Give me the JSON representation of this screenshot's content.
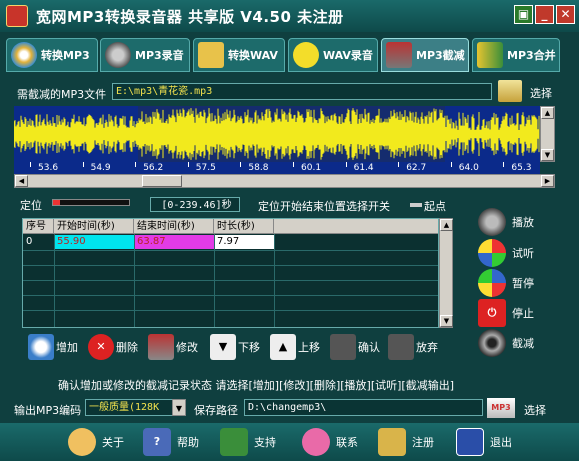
{
  "window": {
    "title": "宽网MP3转换录音器 共享版 V4.50 未注册"
  },
  "tabs": [
    {
      "label": "转换MP3",
      "icon": "cd-disc-icon"
    },
    {
      "label": "MP3录音",
      "icon": "speaker-icon"
    },
    {
      "label": "转换WAV",
      "icon": "speaker-box-icon"
    },
    {
      "label": "WAV录音",
      "icon": "smiley-icon"
    },
    {
      "label": "MP3截减",
      "icon": "scissors-icon"
    },
    {
      "label": "MP3合并",
      "icon": "people-icon"
    }
  ],
  "file": {
    "label": "需截减的MP3文件",
    "value": "E:\\mp3\\青花瓷.mp3",
    "browse_label": "选择"
  },
  "ruler": {
    "ticks": [
      "53.6",
      "54.9",
      "56.2",
      "57.5",
      "58.8",
      "60.1",
      "61.4",
      "62.7",
      "64.0",
      "65.3"
    ]
  },
  "position": {
    "label": "定位",
    "range": "[0-239.46]秒",
    "switch_label": "定位开始结束位置选择开关",
    "switch_end": "起点"
  },
  "table": {
    "headers": [
      "序号",
      "开始时间(秒)",
      "结束时间(秒)",
      "时长(秒)"
    ],
    "rows": [
      {
        "index": "0",
        "start": "55.90",
        "end": "63.87",
        "duration": "7.97"
      }
    ]
  },
  "actions": [
    {
      "label": "增加",
      "icon": "stopwatch-icon"
    },
    {
      "label": "删除",
      "icon": "delete-icon"
    },
    {
      "label": "修改",
      "icon": "edit-icon"
    },
    {
      "label": "下移",
      "icon": "arrow-down-icon"
    },
    {
      "label": "上移",
      "icon": "arrow-up-icon"
    },
    {
      "label": "确认",
      "icon": "confirm-icon"
    },
    {
      "label": "放弃",
      "icon": "cancel-icon"
    }
  ],
  "side_buttons": [
    {
      "label": "播放",
      "icon": "speaker-play-icon"
    },
    {
      "label": "试听",
      "icon": "play-icon"
    },
    {
      "label": "暂停",
      "icon": "pause-icon"
    },
    {
      "label": "停止",
      "icon": "power-stop-icon"
    },
    {
      "label": "截减",
      "icon": "film-reel-icon"
    }
  ],
  "status": "确认增加或修改的截减记录状态 请选择[增加][修改][删除][播放][试听][截减输出]",
  "output": {
    "encoding_label": "输出MP3编码",
    "encoding_value": "一般质量(128K",
    "path_label": "保存路径",
    "path_value": "D:\\changemp3\\",
    "browse_label": "选择",
    "browse_icon": "mp3-folder-icon"
  },
  "bottom_buttons": [
    {
      "label": "关于",
      "icon": "about-icon"
    },
    {
      "label": "帮助",
      "icon": "help-icon"
    },
    {
      "label": "支持",
      "icon": "house-icon"
    },
    {
      "label": "联系",
      "icon": "contact-icon"
    },
    {
      "label": "注册",
      "icon": "key-icon"
    },
    {
      "label": "退出",
      "icon": "exit-icon"
    }
  ],
  "colors": {
    "background": "#0f3f3f",
    "wave_bg": "#0b2a8a",
    "wave": "#f2ea1d",
    "start_cell": "#00e5ee",
    "end_cell": "#e23be6",
    "field_text": "#f2e24e"
  }
}
